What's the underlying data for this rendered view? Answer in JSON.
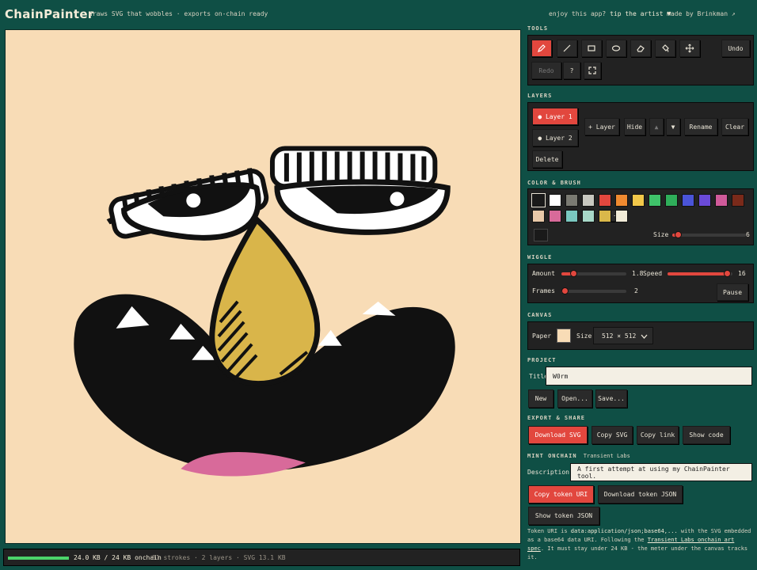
{
  "app": {
    "title": "ChainPainter",
    "tagline": "draws SVG that wobbles · exports on-chain ready",
    "tip_prefix": "enjoy this app?",
    "tip_link": "tip the artist ♥",
    "made_by": "made by Brinkman ↗"
  },
  "status": {
    "meter_fraction": 1.0,
    "meter_text": "24.0 KB / 24 KB onchain",
    "stats_text": "81 strokes · 2 layers · SVG 13.1 KB"
  },
  "tools": {
    "title": "TOOLS",
    "items": [
      {
        "name": "pencil-icon",
        "active": true
      },
      {
        "name": "line-icon",
        "active": false
      },
      {
        "name": "rectangle-icon",
        "active": false
      },
      {
        "name": "ellipse-icon",
        "active": false
      },
      {
        "name": "eraser-icon",
        "active": false
      },
      {
        "name": "fill-bucket-icon",
        "active": false
      },
      {
        "name": "move-icon",
        "active": false
      }
    ],
    "undo": "Undo",
    "redo": "Redo",
    "help": "?",
    "fullscreen_icon": "fullscreen-icon"
  },
  "layers": {
    "title": "LAYERS",
    "items": [
      {
        "label": "● Layer 1",
        "active": true
      },
      {
        "label": "● Layer 2",
        "active": false
      }
    ],
    "add": "+ Layer",
    "hide": "Hide",
    "up": "▲",
    "down": "▼",
    "rename": "Rename",
    "clear": "Clear",
    "delete": "Delete"
  },
  "color": {
    "title": "COLOR & BRUSH",
    "palette": [
      "#1a1a1a",
      "#ffffff",
      "#7a7a72",
      "#c8c8c0",
      "#e2473e",
      "#f08a30",
      "#f2c84a",
      "#3fc36a",
      "#2fae5a",
      "#4a54d8",
      "#6a4ad8",
      "#d05a9a",
      "#7a2a1a",
      "#e8c8a8",
      "#d86a9a",
      "#7ac8c0",
      "#a8d8c8",
      "#dab84a",
      "#f2ecd8"
    ],
    "add": "+",
    "current": "#1a1a1a",
    "size_label": "Size",
    "size_value": "6",
    "size_fraction": 0.04
  },
  "wiggle": {
    "title": "WIGGLE",
    "amount_label": "Amount",
    "amount_value": "1.8",
    "amount_fraction": 0.15,
    "speed_label": "Speed",
    "speed_value": "16",
    "speed_fraction": 0.97,
    "frames_label": "Frames",
    "frames_value": "2",
    "frames_fraction": 0.0,
    "pause": "Pause"
  },
  "canvas": {
    "title": "CANVAS",
    "paper_label": "Paper",
    "paper_color": "#f8dcb6",
    "size_label": "Size",
    "size_value": "512 × 512"
  },
  "project": {
    "title": "PROJECT",
    "title_label": "Title",
    "title_value": "W0rm",
    "new": "New",
    "open": "Open...",
    "save": "Save..."
  },
  "export": {
    "title": "EXPORT & SHARE",
    "download_svg": "Download SVG",
    "copy_svg": "Copy SVG",
    "copy_link": "Copy link",
    "show_code": "Show code"
  },
  "mint": {
    "title": "MINT ONCHAIN",
    "subtitle": "Transient Labs",
    "description_label": "Description",
    "description_value": "A first attempt at using my ChainPainter tool.",
    "copy_uri": "Copy token URI",
    "download_json": "Download token JSON",
    "show_json": "Show token JSON",
    "footnote_a": "Token URI is",
    "footnote_code": "data:application/json;base64,...",
    "footnote_b": "with the SVG embedded as a base64 data URI. Following the",
    "footnote_link": "Transient Labs onchain art spec",
    "footnote_c": ". It must stay under 24 KB - the meter under the canvas tracks it."
  },
  "colors": {
    "background": "#0f4f45",
    "panel": "#222222",
    "accent": "#e2473e",
    "meter": "#4bd36a"
  }
}
